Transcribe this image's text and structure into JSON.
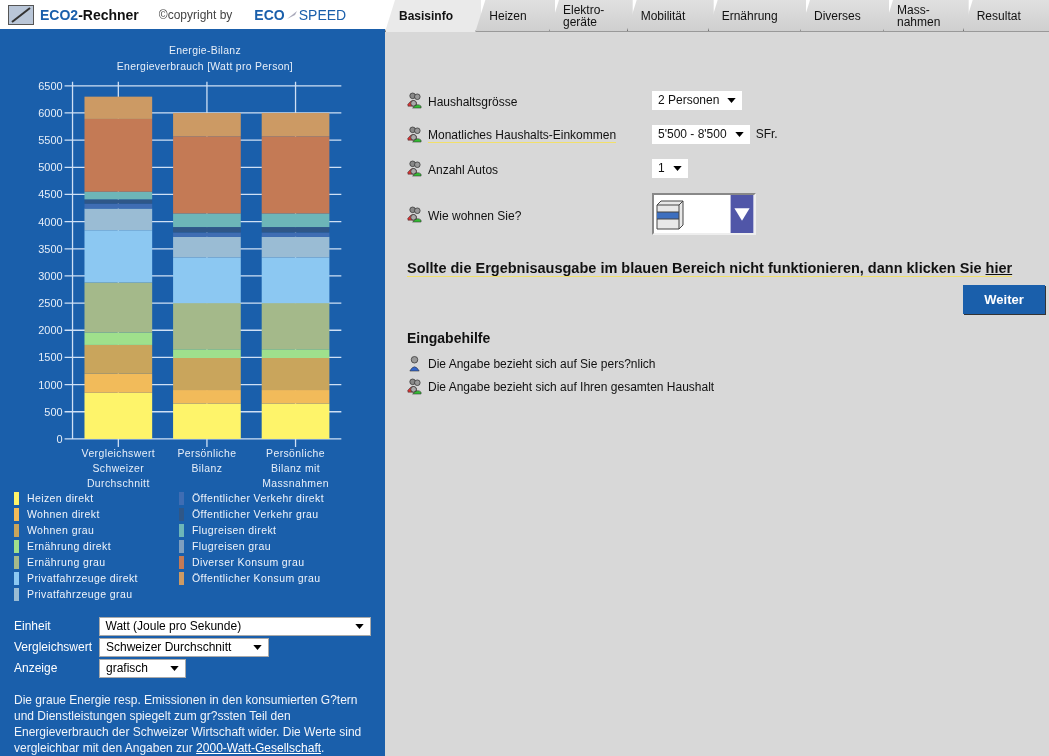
{
  "header": {
    "app_brand": "ECO2",
    "app_name": "-Rechner",
    "copyright": "©copyright by",
    "eco": "ECO",
    "speed": "SPEED"
  },
  "tabs": [
    {
      "label": "Basisinfo",
      "selected": true
    },
    {
      "label": "Heizen",
      "selected": false
    },
    {
      "label": "Elektro-\ngeräte",
      "selected": false
    },
    {
      "label": "Mobilität",
      "selected": false
    },
    {
      "label": "Ernährung",
      "selected": false
    },
    {
      "label": "Diverses",
      "selected": false
    },
    {
      "label": "Mass-\nnahmen",
      "selected": false
    },
    {
      "label": "Resultat",
      "selected": false
    }
  ],
  "sidebar": {
    "chart_data": {
      "type": "bar",
      "stacked": true,
      "title": "Energie-Bilanz",
      "ylabel": "Energieverbrauch [Watt pro Person]",
      "grid": true,
      "categories": [
        "Vergleichswert\nSchweizer\nDurchschnitt",
        "Persönliche\nBilanz",
        "Persönliche\nBilanz mit\nMassnahmen"
      ],
      "ylim": [
        0,
        6500
      ],
      "yticks": [
        0,
        500,
        1000,
        1500,
        2000,
        2500,
        3000,
        3500,
        4000,
        4500,
        5000,
        5500,
        6000,
        6500
      ],
      "series": [
        {
          "name": "Heizen direkt",
          "color": "#fef46a",
          "values": [
            850,
            650,
            650
          ]
        },
        {
          "name": "Wohnen direkt",
          "color": "#f2bb5a",
          "values": [
            350,
            250,
            250
          ]
        },
        {
          "name": "Wohnen grau",
          "color": "#c9a55c",
          "values": [
            530,
            590,
            590
          ]
        },
        {
          "name": "Ernährung direkt",
          "color": "#9fe08c",
          "values": [
            230,
            160,
            160
          ]
        },
        {
          "name": "Ernährung grau",
          "color": "#a4b98a",
          "values": [
            920,
            850,
            850
          ]
        },
        {
          "name": "Privatfahrzeuge direkt",
          "color": "#8cc8f2",
          "values": [
            960,
            840,
            840
          ]
        },
        {
          "name": "Privatfahrzeuge grau",
          "color": "#9abcd4",
          "values": [
            400,
            380,
            380
          ]
        },
        {
          "name": "Öffentlicher Verkehr direkt",
          "color": "#3f6db3",
          "values": [
            90,
            80,
            80
          ]
        },
        {
          "name": "Öffentlicher Verkehr grau",
          "color": "#2f5788",
          "values": [
            80,
            100,
            100
          ]
        },
        {
          "name": "Flugreisen direkt",
          "color": "#6db6b8",
          "values": [
            140,
            250,
            250
          ]
        },
        {
          "name": "Flugreisen grau",
          "color": "#7f9fbf",
          "values": [
            0,
            0,
            0
          ]
        },
        {
          "name": "Diverser Konsum grau",
          "color": "#c47a55",
          "values": [
            1340,
            1420,
            1420
          ]
        },
        {
          "name": "Öffentlicher Konsum grau",
          "color": "#cc9a64",
          "values": [
            410,
            430,
            430
          ]
        }
      ]
    },
    "settings": [
      {
        "label": "Einheit",
        "value": "Watt (Joule pro Sekunde)",
        "kind": "wide-dropdown"
      },
      {
        "label": "Vergleichswert",
        "value": "Schweizer Durchschnitt",
        "kind": "dropdown"
      },
      {
        "label": "Anzeige",
        "value": "grafisch",
        "kind": "dropdown"
      }
    ],
    "note": {
      "text": "Die graue Energie resp. Emissionen in den konsumierten G?tern und Dienstleistungen spiegelt zum gr?ssten Teil den Energieverbrauch der Schweizer Wirtschaft wider. Die Werte sind vergleichbar mit den Angaben zur ",
      "link": "2000-Watt-Gesellschaft",
      "after": "."
    }
  },
  "form": {
    "rows": [
      {
        "kind": "dropdown",
        "label": "Haushaltsgrösse",
        "hint": false,
        "value": "2 Personen"
      },
      {
        "kind": "dropdown",
        "label": "Monatliches Haushalts-Einkommen",
        "hint": true,
        "value": "5'500 - 8'500",
        "unit": "SFr."
      },
      {
        "kind": "dropdown",
        "label": "Anzahl Autos",
        "hint": false,
        "value": "1"
      },
      {
        "kind": "image-dropdown",
        "label": "Wie wohnen Sie?",
        "hint": false
      }
    ],
    "notice": {
      "text": "Sollte die Ergebnisausgabe im blauen Bereich nicht funktionieren, dann klicken Sie ",
      "link": "hier"
    },
    "next_button": "Weiter",
    "help": {
      "title": "Eingabehilfe",
      "items": [
        {
          "kind": "person",
          "text": "Die Angabe bezieht sich auf Sie pers?nlich"
        },
        {
          "kind": "household",
          "text": "Die Angabe bezieht sich auf Ihren gesamten Haushalt"
        }
      ]
    }
  }
}
